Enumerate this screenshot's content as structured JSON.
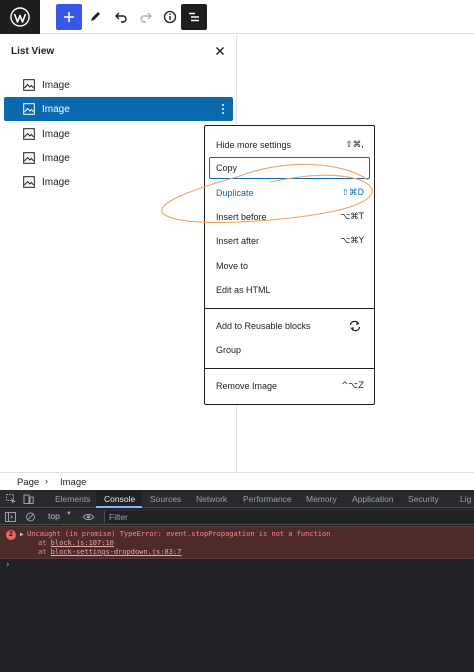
{
  "toolbar": {
    "logo_icon": "wordpress-logo",
    "add_icon": "plus-icon",
    "edit_icon": "pencil-icon",
    "undo_icon": "undo-icon",
    "redo_icon": "redo-icon",
    "info_icon": "info-icon",
    "list_view_icon": "list-view-icon"
  },
  "list_view": {
    "title": "List View",
    "close_icon": "close-icon",
    "items": [
      {
        "label": "Image"
      },
      {
        "label": "Image"
      },
      {
        "label": "Image"
      },
      {
        "label": "Image"
      },
      {
        "label": "Image"
      }
    ],
    "selected_index": 1
  },
  "menu": {
    "items": [
      {
        "label": "Hide more settings",
        "shortcut": "⇧⌘,"
      },
      {
        "label": "Copy",
        "shortcut": ""
      },
      {
        "label": "Duplicate",
        "shortcut": "⇧⌘D"
      },
      {
        "label": "Insert before",
        "shortcut": "⌥⌘T"
      },
      {
        "label": "Insert after",
        "shortcut": "⌥⌘Y"
      },
      {
        "label": "Move to",
        "shortcut": ""
      },
      {
        "label": "Edit as HTML",
        "shortcut": ""
      },
      {
        "label": "Add to Reusable blocks",
        "shortcut": ""
      },
      {
        "label": "Group",
        "shortcut": ""
      },
      {
        "label": "Remove Image",
        "shortcut": "^⌥Z"
      }
    ]
  },
  "breadcrumb": {
    "root": "Page",
    "separator": "›",
    "current": "Image"
  },
  "devtools": {
    "tabs": [
      "Elements",
      "Console",
      "Sources",
      "Network",
      "Performance",
      "Memory",
      "Application",
      "Security",
      "Lig"
    ],
    "active_tab": "Console",
    "context": "top",
    "filter_placeholder": "Filter",
    "error": {
      "count": "2",
      "message": "Uncaught (in promise) TypeError: event.stopPropagation is not a function",
      "frame1_prefix": "at ",
      "frame1_link": "block.js:107:10",
      "frame2_prefix": "at ",
      "frame2_link": "block-settings-dropdown.js:83:7"
    },
    "prompt": "›"
  },
  "colors": {
    "accent": "#3858e9",
    "selected": "#0a6ab0",
    "annotation": "#f5a05a",
    "console_error": "#f28b82"
  }
}
